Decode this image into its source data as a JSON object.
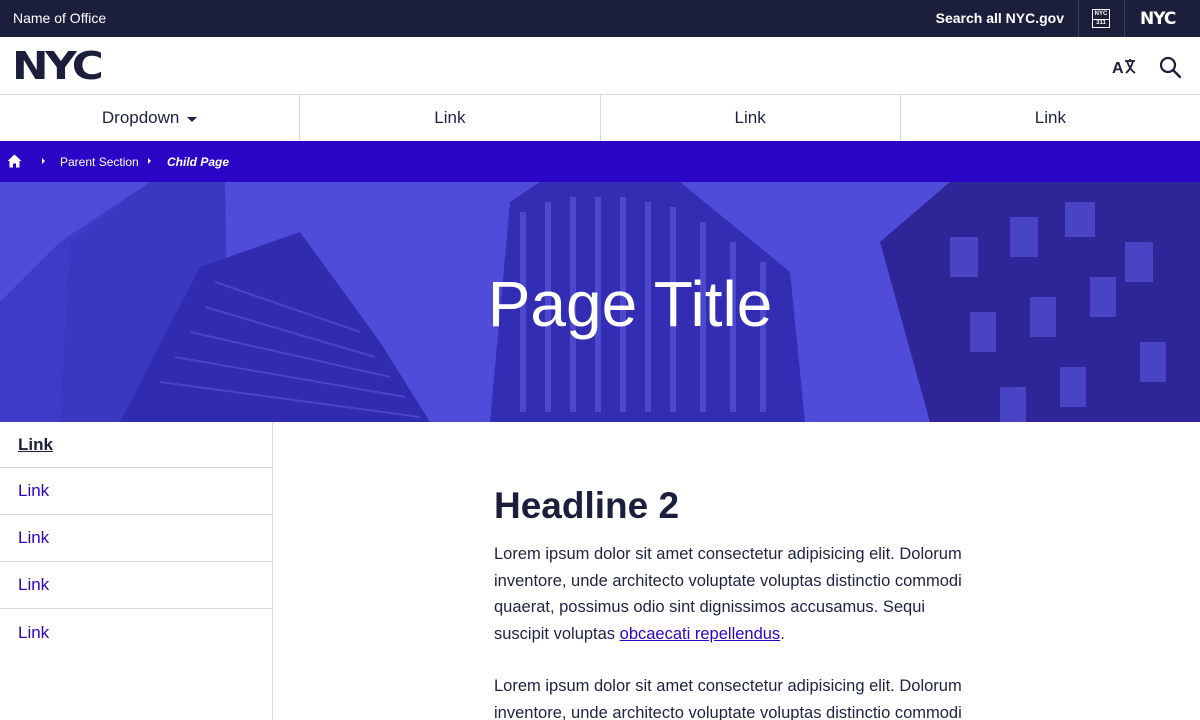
{
  "utility": {
    "office_name": "Name of Office",
    "search_all": "Search all NYC.gov",
    "badge_311_top": "NYC",
    "badge_311_bottom": "311",
    "nyc_mark": "NYC"
  },
  "header": {
    "logo_text": "NYC",
    "icons": [
      "translate-icon",
      "search-icon"
    ]
  },
  "nav": {
    "items": [
      {
        "label": "Dropdown",
        "has_caret": true
      },
      {
        "label": "Link"
      },
      {
        "label": "Link"
      },
      {
        "label": "Link"
      }
    ]
  },
  "breadcrumb": {
    "home_icon": "home-icon",
    "parent": "Parent Section",
    "child": "Child Page"
  },
  "hero": {
    "title": "Page Title"
  },
  "sidebar": {
    "items": [
      {
        "label": "Link",
        "active": true
      },
      {
        "label": "Link"
      },
      {
        "label": "Link"
      },
      {
        "label": "Link"
      },
      {
        "label": "Link"
      }
    ]
  },
  "main": {
    "headline": "Headline 2",
    "paragraph1_text": "Lorem ipsum dolor sit amet consectetur adipisicing elit. Dolorum inventore, unde architecto voluptate voluptas distinctio commodi quaerat, possimus odio sint dignissimos accusamus. Sequi suscipit voluptas",
    "paragraph1_link": "obcaecati repellendus",
    "paragraph1_end": ".",
    "paragraph2_text": "Lorem ipsum dolor sit amet consectetur adipisicing elit. Dolorum inventore, unde architecto voluptate voluptas distinctio commodi"
  },
  "colors": {
    "utility_bg": "#1c1f3b",
    "brand_blue": "#2b05c5",
    "hero_tint": "#4d49d7",
    "text_dark": "#1d2340"
  }
}
